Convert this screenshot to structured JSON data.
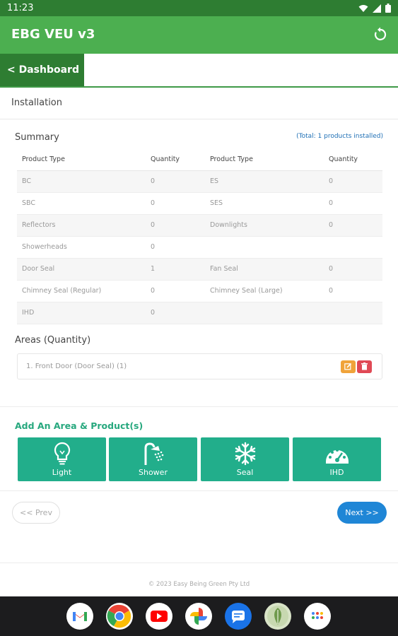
{
  "status_bar": {
    "time": "11:23"
  },
  "app_bar": {
    "title": "EBG VEU v3"
  },
  "nav": {
    "dashboard_label": "< Dashboard"
  },
  "page": {
    "section_title": "Installation"
  },
  "summary": {
    "label": "Summary",
    "total_note": "(Total: 1 products installed)",
    "headers": [
      "Product Type",
      "Quantity",
      "Product Type",
      "Quantity"
    ],
    "rows": [
      [
        "BC",
        "0",
        "ES",
        "0"
      ],
      [
        "SBC",
        "0",
        "SES",
        "0"
      ],
      [
        "Reflectors",
        "0",
        "Downlights",
        "0"
      ],
      [
        "Showerheads",
        "0",
        "",
        ""
      ],
      [
        "Door Seal",
        "1",
        "Fan Seal",
        "0"
      ],
      [
        "Chimney Seal (Regular)",
        "0",
        "Chimney Seal (Large)",
        "0"
      ],
      [
        "IHD",
        "0",
        "",
        ""
      ]
    ]
  },
  "areas": {
    "label": "Areas (Quantity)",
    "items": [
      {
        "text": "1. Front Door (Door Seal) (1)"
      }
    ]
  },
  "add_section": {
    "label": "Add An Area & Product(s)",
    "tiles": [
      {
        "label": "Light",
        "icon": "lightbulb-icon"
      },
      {
        "label": "Shower",
        "icon": "shower-icon"
      },
      {
        "label": "Seal",
        "icon": "snowflake-icon"
      },
      {
        "label": "IHD",
        "icon": "gauge-icon"
      }
    ]
  },
  "pagination": {
    "prev_label": "<< Prev",
    "next_label": "Next >>"
  },
  "footer": {
    "text": "© 2023 Easy Being Green Pty Ltd"
  },
  "colors": {
    "app_bar": "#4caf50",
    "status_bar": "#2e7d32",
    "tile": "#22ae8b",
    "next_button": "#1f86d6",
    "edit_button": "#f0a33a",
    "delete_button": "#e04955"
  },
  "dock_apps": [
    "gmail-icon",
    "chrome-icon",
    "youtube-icon",
    "photos-icon",
    "messages-icon",
    "leaf-app-icon",
    "app-drawer-icon"
  ]
}
